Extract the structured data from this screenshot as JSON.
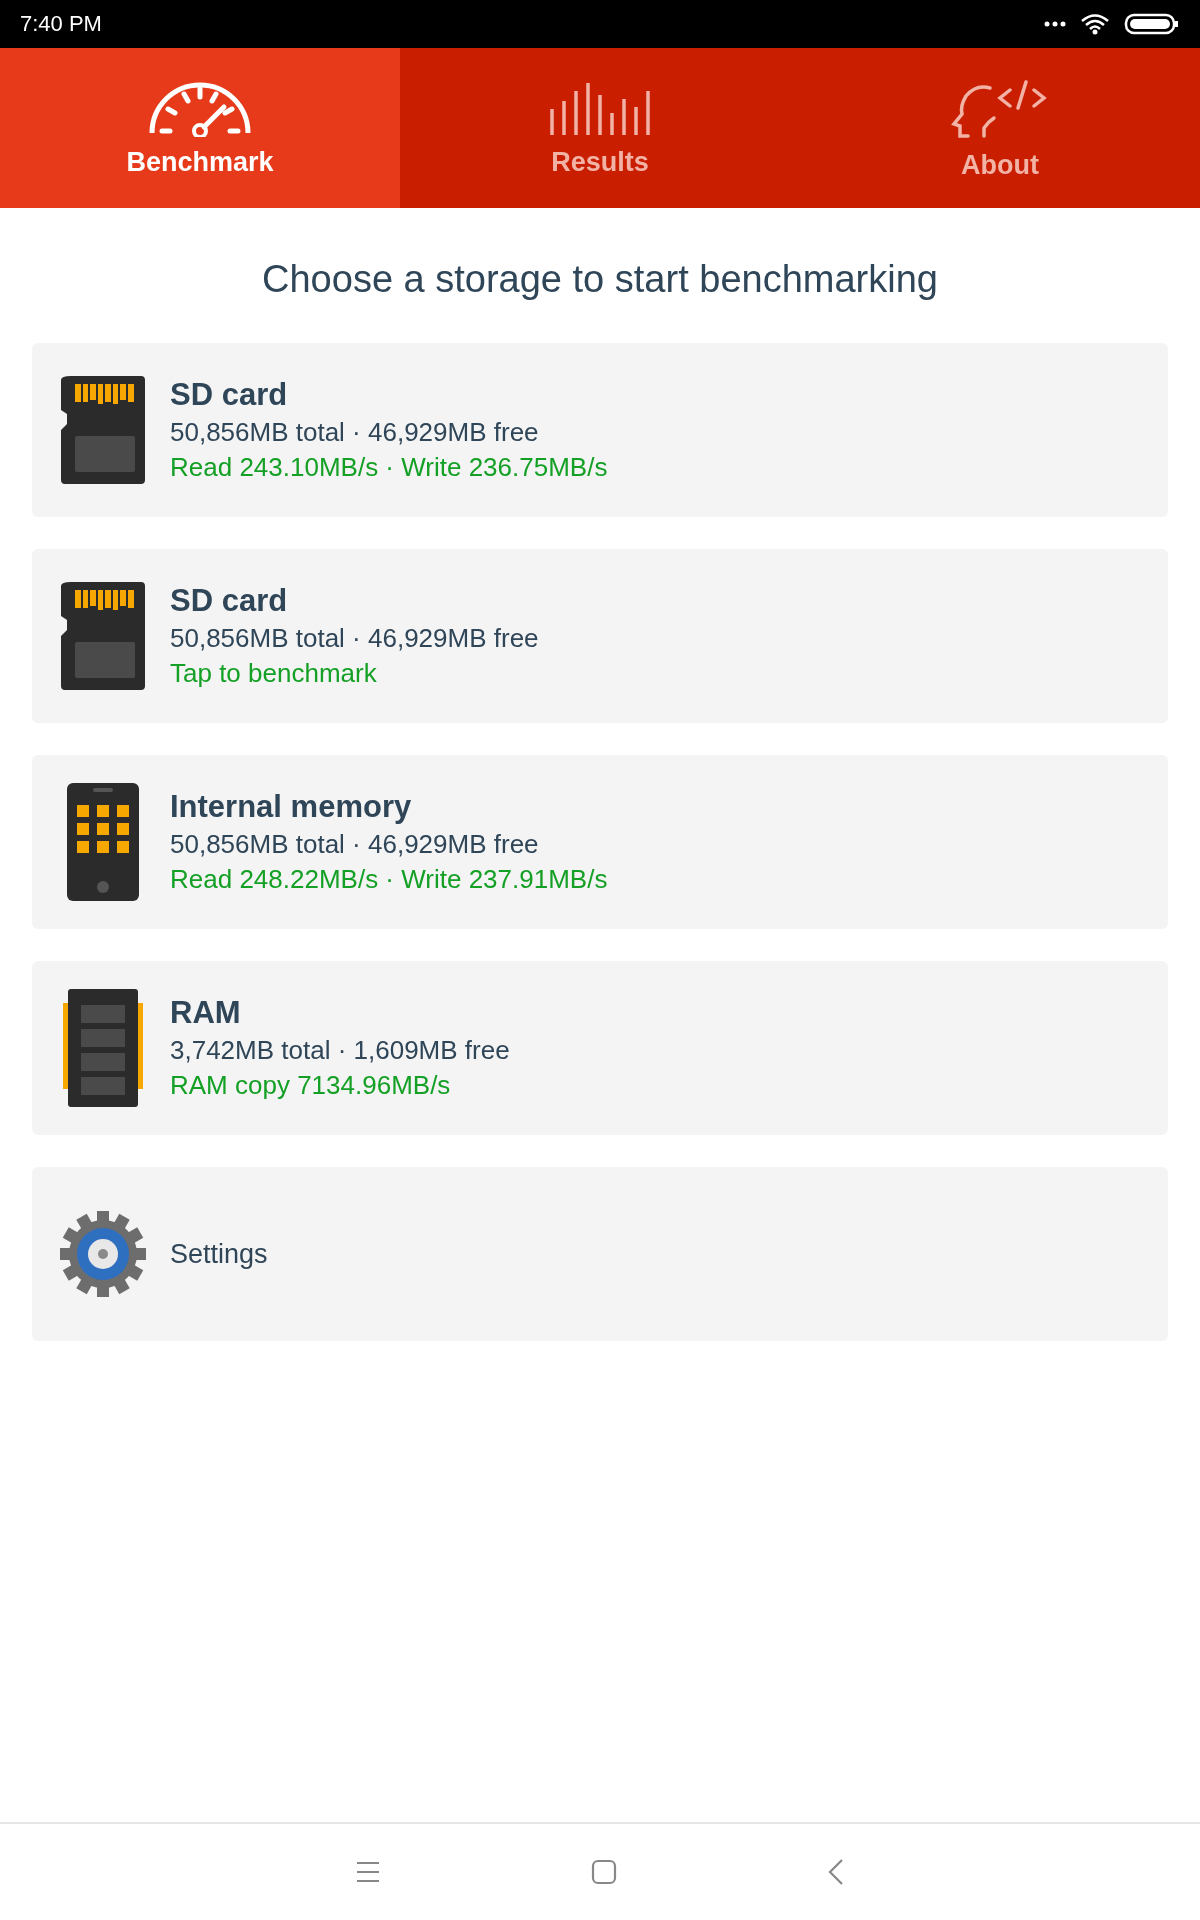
{
  "status_bar": {
    "time": "7:40 PM"
  },
  "tabs": [
    {
      "label": "Benchmark",
      "kind": "gauge",
      "selected": true
    },
    {
      "label": "Results",
      "kind": "bars",
      "selected": false
    },
    {
      "label": "About",
      "kind": "head",
      "selected": false
    }
  ],
  "heading": "Choose a storage to start benchmarking",
  "storages": [
    {
      "kind": "sd",
      "name": "SD card",
      "capacity": "50,856MB total · 46,929MB free",
      "result": "Read 243.10MB/s · Write 236.75MB/s"
    },
    {
      "kind": "sd",
      "name": "SD card",
      "capacity": "50,856MB total · 46,929MB free",
      "result": "Tap to benchmark"
    },
    {
      "kind": "phone",
      "name": "Internal memory",
      "capacity": "50,856MB total · 46,929MB free",
      "result": "Read 248.22MB/s · Write 237.91MB/s"
    },
    {
      "kind": "ram",
      "name": "RAM",
      "capacity": "3,742MB total · 1,609MB free",
      "result": "RAM copy 7134.96MB/s"
    },
    {
      "kind": "settings",
      "name": "Settings"
    }
  ]
}
